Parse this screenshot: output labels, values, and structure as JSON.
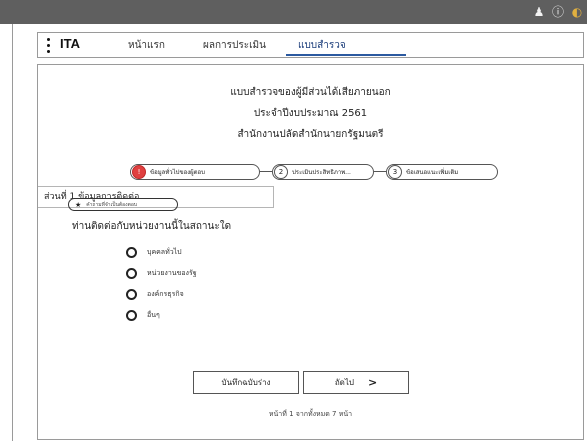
{
  "system_bar": {
    "icons": [
      "user-icon",
      "info-icon",
      "app-logo-icon"
    ],
    "user_glyph": "♟",
    "info_glyph": "ⓘ",
    "logo_glyph": "◐"
  },
  "navbar": {
    "brand": "ITA",
    "tabs": [
      {
        "label": "หน้าแรก",
        "active": false
      },
      {
        "label": "ผลการประเมิน",
        "active": false
      },
      {
        "label": "แบบสำรวจ",
        "active": true
      }
    ]
  },
  "survey": {
    "title_line1": "แบบสำรวจของผู้มีส่วนได้เสียภายนอก",
    "title_line2": "ประจำปีงบประมาณ 2561",
    "title_line3": "สำนักงานปลัดสำนักนายกรัฐมนตรี"
  },
  "steps": [
    {
      "number": "!",
      "label": "ข้อมูลทั่วไปของผู้ตอบ",
      "active": true
    },
    {
      "number": "2",
      "label": "ประเมินประสิทธิภาพ...",
      "active": false
    },
    {
      "number": "3",
      "label": "ข้อเสนอแนะเพิ่มเติม",
      "active": false
    }
  ],
  "section": {
    "header": "ส่วนที่ 1 ข้อมูลการติดต่อ",
    "required_badge": "คำถามที่จำเป็นต้องตอบ",
    "required_icon": "star-icon",
    "question": "ท่านติดต่อกับหน่วยงานนี้ในสถานะใด",
    "options": [
      "บุคคลทั่วไป",
      "หน่วยงานของรัฐ",
      "องค์กรธุรกิจ",
      "อื่นๆ"
    ]
  },
  "buttons": {
    "save_draft": "บันทึกฉบับร่าง",
    "next": "ถัดไป",
    "next_arrow": ">"
  },
  "pager": {
    "text": "หน้าที่ 1 จากทั้งหมด 7 หน้า"
  },
  "colors": {
    "topbar": "#5f5f5f",
    "active_step": "#e04040",
    "active_tab_underline": "#2c5aa0"
  }
}
